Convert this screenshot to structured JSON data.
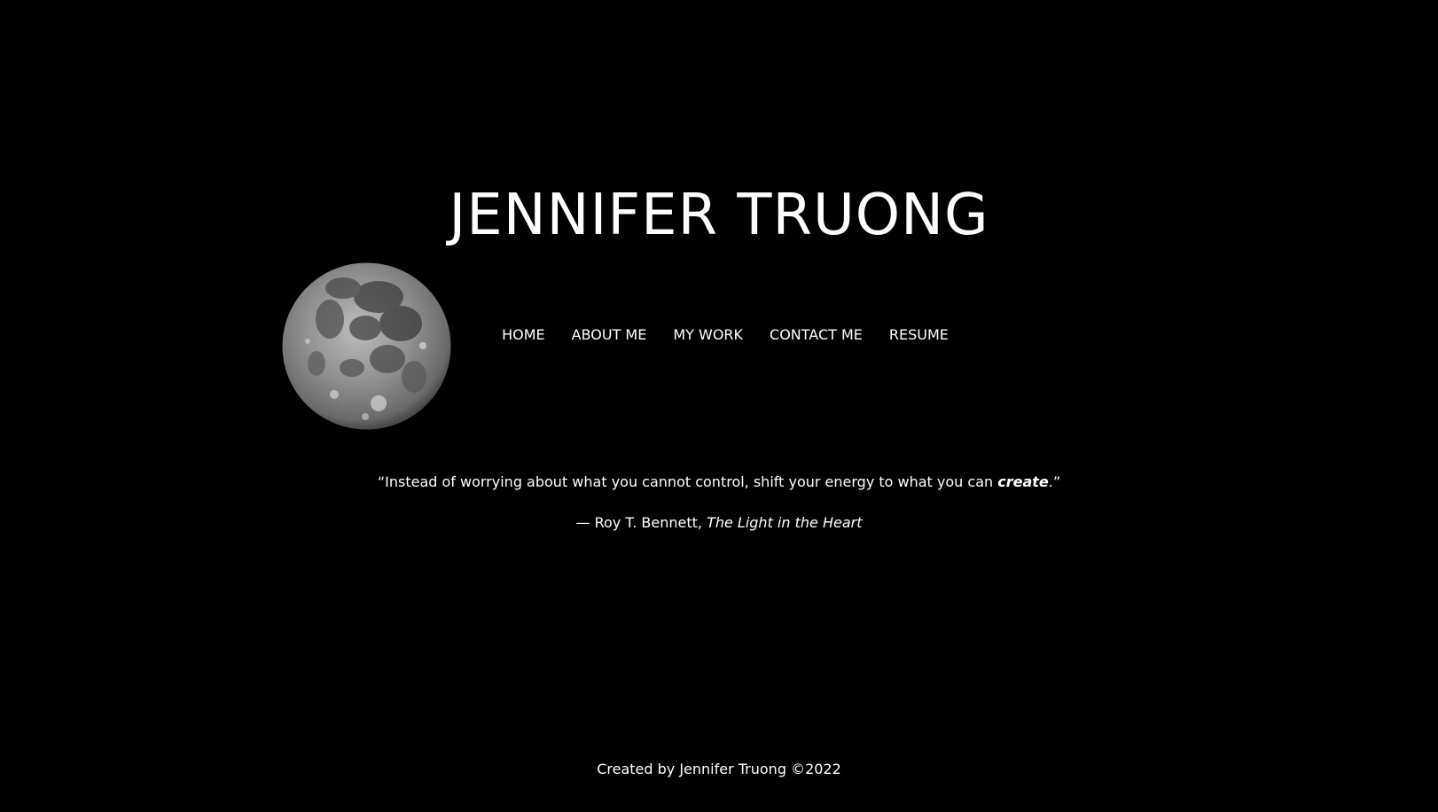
{
  "header": {
    "title": "JENNIFER TRUONG"
  },
  "nav": {
    "items": [
      {
        "label": "HOME"
      },
      {
        "label": "ABOUT ME"
      },
      {
        "label": "MY WORK"
      },
      {
        "label": "CONTACT ME"
      },
      {
        "label": "RESUME"
      }
    ]
  },
  "quote": {
    "open_mark": "“",
    "text_before": "Instead of worrying about what you cannot control, shift your energy to what you can ",
    "emphasis": "create",
    "text_after": ".",
    "close_mark": "”"
  },
  "attribution": {
    "prefix": "— Roy T. Bennett, ",
    "book": "The Light in the Heart"
  },
  "footer": {
    "text": "Created by Jennifer Truong ©2022"
  },
  "colors": {
    "background": "#000000",
    "text": "#ffffff"
  },
  "icons": {
    "moon": "moon-image"
  }
}
